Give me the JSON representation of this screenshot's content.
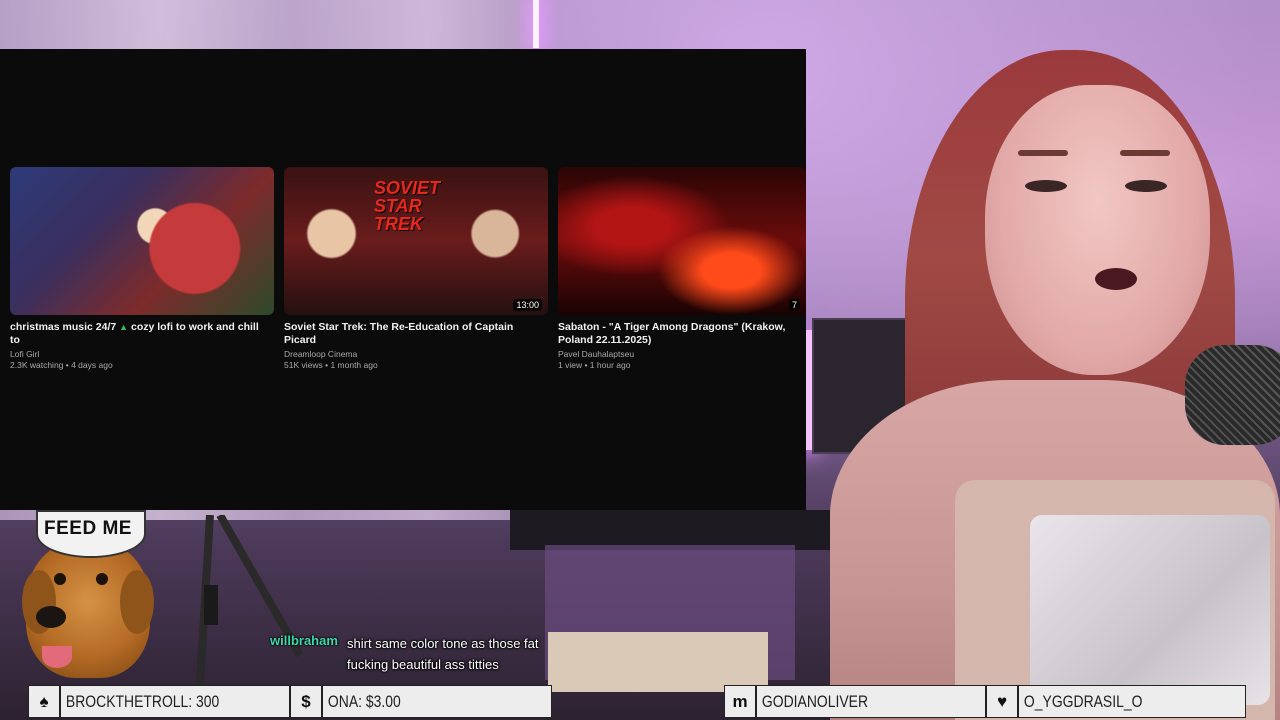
{
  "youtube": {
    "videos": [
      {
        "title": "christmas music 24/7",
        "title_icon": "tree-icon",
        "title_suffix": "cozy lofi to work and chill to",
        "channel": "Lofi Girl",
        "meta": "2.3K watching • 4 days ago",
        "duration": ""
      },
      {
        "title": "Soviet Star Trek: The Re-Education of Captain Picard",
        "channel": "Dreamloop Cinema",
        "meta": "51K views • 1 month ago",
        "duration": "13:00",
        "thumb_logo": "SOVIET STAR TREK"
      },
      {
        "title": "Sabaton - \"A Tiger Among Dragons\" (Krakow, Poland 22.11.2025)",
        "channel": "Pavel Dauhalaptseu",
        "meta": "1 view • 1 hour ago",
        "duration": "7"
      }
    ]
  },
  "chat": {
    "username": "willbraham",
    "username_color": "#3fd6a8",
    "message": "shirt same color tone as those fat fucking beautiful ass titties"
  },
  "overlay": {
    "feed_me_label": "FEED ME"
  },
  "alerts": [
    {
      "icon": "spade-icon",
      "glyph": "♠",
      "text": "BROCKTHETROLL: 300"
    },
    {
      "icon": "dollar-icon",
      "glyph": "$",
      "text": "ONA: $3.00"
    },
    {
      "icon": "m-icon",
      "glyph": "m",
      "text": "GODIANOLIVER"
    },
    {
      "icon": "heart-icon",
      "glyph": "♥",
      "text": "O_YGGDRASIL_O"
    }
  ]
}
